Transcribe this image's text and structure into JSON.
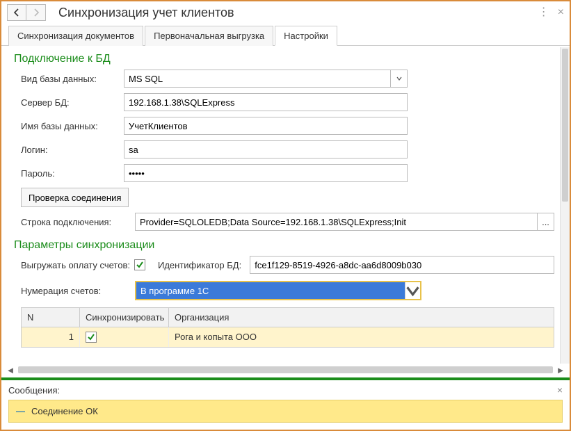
{
  "header": {
    "title": "Синхронизация учет клиентов"
  },
  "tabs": [
    {
      "label": "Синхронизация документов",
      "active": false
    },
    {
      "label": "Первоначальная выгрузка",
      "active": false
    },
    {
      "label": "Настройки",
      "active": true
    }
  ],
  "db": {
    "section_title": "Подключение к БД",
    "type_label": "Вид базы данных:",
    "type_value": "MS SQL",
    "server_label": "Сервер БД:",
    "server_value": "192.168.1.38\\SQLExpress",
    "name_label": "Имя базы данных:",
    "name_value": "УчетКлиентов",
    "login_label": "Логин:",
    "login_value": "sa",
    "password_label": "Пароль:",
    "password_value": "•••••",
    "test_button": "Проверка соединения",
    "connstr_label": "Строка подключения:",
    "connstr_value": "Provider=SQLOLEDB;Data Source=192.168.1.38\\SQLExpress;Init",
    "ellipsis": "..."
  },
  "sync": {
    "section_title": "Параметры синхронизации",
    "export_pay_label": "Выгружать оплату счетов:",
    "export_pay_checked": true,
    "db_id_label": "Идентификатор БД:",
    "db_id_value": "fce1f129-8519-4926-a8dc-aa6d8009b030",
    "numbering_label": "Нумерация счетов:",
    "numbering_value": "В программе 1С"
  },
  "table": {
    "columns": {
      "n": "N",
      "sync": "Синхронизировать",
      "org": "Организация"
    },
    "rows": [
      {
        "n": "1",
        "sync": true,
        "org": "Рога и копыта ООО"
      }
    ]
  },
  "messages": {
    "title": "Сообщения:",
    "items": [
      {
        "text": "Соединение ОК"
      }
    ]
  }
}
